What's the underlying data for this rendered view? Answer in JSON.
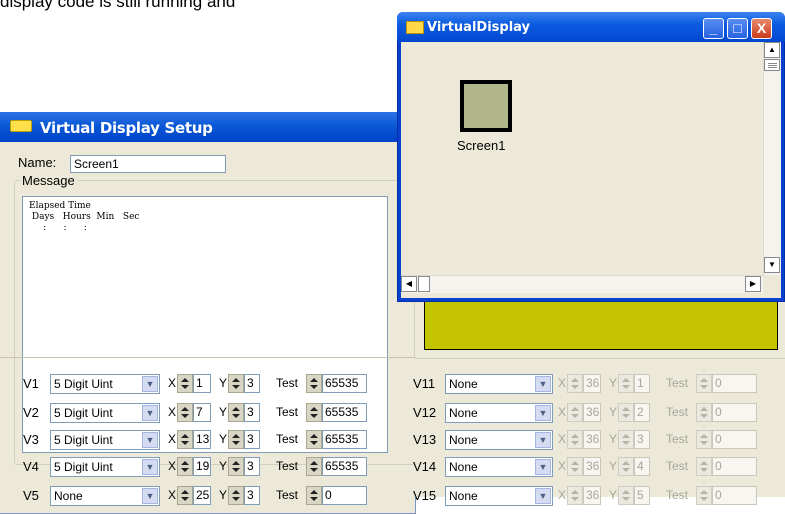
{
  "background_text": "display code is still running and",
  "setup_window": {
    "title": "Virtual Display Setup",
    "name_label": "Name:",
    "name_value": "Screen1",
    "message_label": "Message",
    "message_text": "Elapsed Time\n Days   Hours  Min   Sec\n     :      :      :"
  },
  "virtual_display_window": {
    "title": "VirtualDisplay",
    "screen_label": "Screen1",
    "buttons": {
      "minimize": "_",
      "maximize": "□",
      "close": "X"
    }
  },
  "labels": {
    "x": "X",
    "y": "Y",
    "test": "Test"
  },
  "left_rows": [
    {
      "label": "V1",
      "type": "5 Digit Uint",
      "x": "1",
      "y": "3",
      "test": "65535"
    },
    {
      "label": "V2",
      "type": "5 Digit Uint",
      "x": "7",
      "y": "3",
      "test": "65535"
    },
    {
      "label": "V3",
      "type": "5 Digit Uint",
      "x": "13",
      "y": "3",
      "test": "65535"
    },
    {
      "label": "V4",
      "type": "5 Digit Uint",
      "x": "19",
      "y": "3",
      "test": "65535"
    },
    {
      "label": "V5",
      "type": "None",
      "x": "25",
      "y": "3",
      "test": "0"
    }
  ],
  "right_rows": [
    {
      "label": "V11",
      "type": "None",
      "x": "36",
      "y": "1",
      "test": "0"
    },
    {
      "label": "V12",
      "type": "None",
      "x": "36",
      "y": "2",
      "test": "0"
    },
    {
      "label": "V13",
      "type": "None",
      "x": "36",
      "y": "3",
      "test": "0"
    },
    {
      "label": "V14",
      "type": "None",
      "x": "36",
      "y": "4",
      "test": "0"
    },
    {
      "label": "V15",
      "type": "None",
      "x": "36",
      "y": "5",
      "test": "0"
    }
  ],
  "colors": {
    "display_panel": "#c4c400",
    "screen_icon": "#b1b68d",
    "titlebar": "#0a58d6"
  }
}
